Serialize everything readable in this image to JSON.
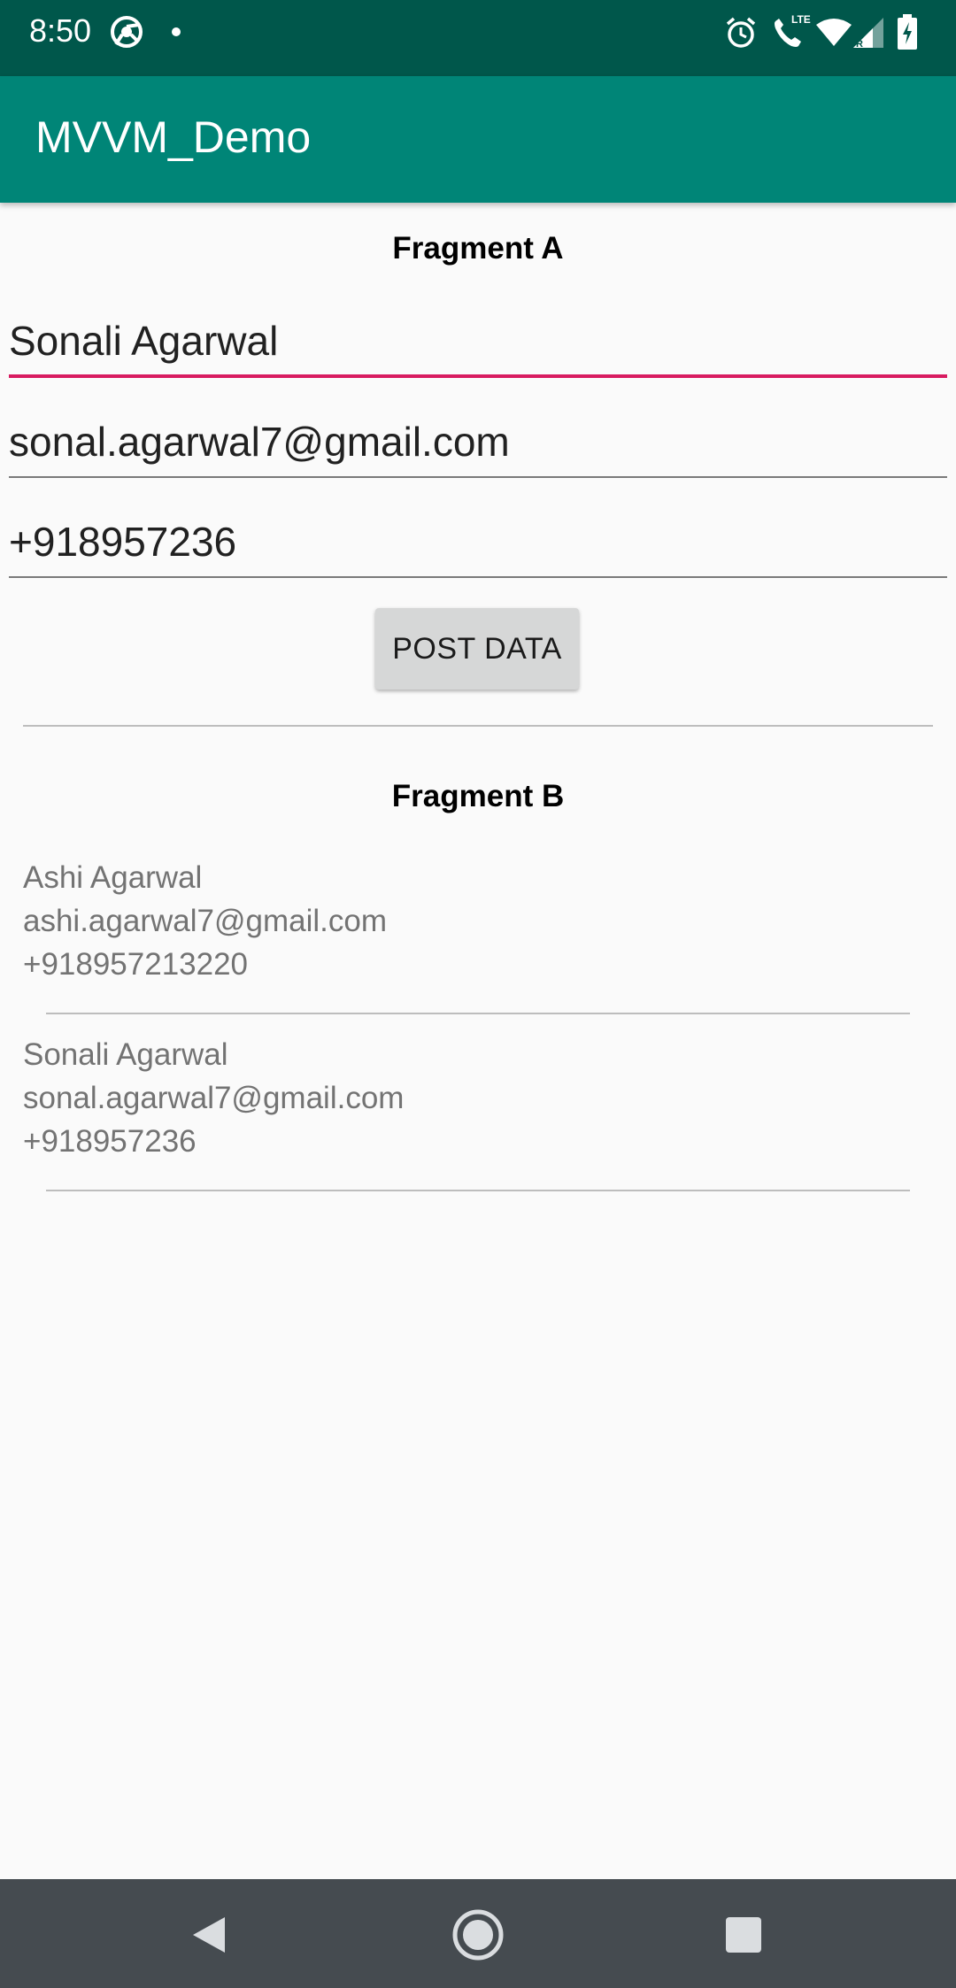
{
  "status_bar": {
    "time": "8:50",
    "left_icons": [
      "chrome-icon",
      "notification-dot-icon"
    ],
    "right_icons": [
      "alarm-icon",
      "lte-call-icon",
      "wifi-icon",
      "signal-icon",
      "battery-charging-icon"
    ],
    "lte_label": "LTE",
    "roaming_label": "R"
  },
  "app_bar": {
    "title": "MVVM_Demo"
  },
  "fragment_a": {
    "title": "Fragment A",
    "name_value": "Sonali Agarwal",
    "email_value": "sonal.agarwal7@gmail.com",
    "phone_value": "+918957236",
    "post_button_label": "POST DATA"
  },
  "fragment_b": {
    "title": "Fragment B",
    "items": [
      {
        "name": "Ashi Agarwal",
        "email": "ashi.agarwal7@gmail.com",
        "phone": "+918957213220"
      },
      {
        "name": "Sonali Agarwal",
        "email": "sonal.agarwal7@gmail.com",
        "phone": "+918957236"
      }
    ]
  },
  "nav_bar": {
    "icons": [
      "back-icon",
      "home-icon",
      "recents-icon"
    ]
  },
  "colors": {
    "status_bar": "#00574B",
    "app_bar": "#008577",
    "accent": "#D81B60",
    "nav_bar": "#454B50"
  }
}
